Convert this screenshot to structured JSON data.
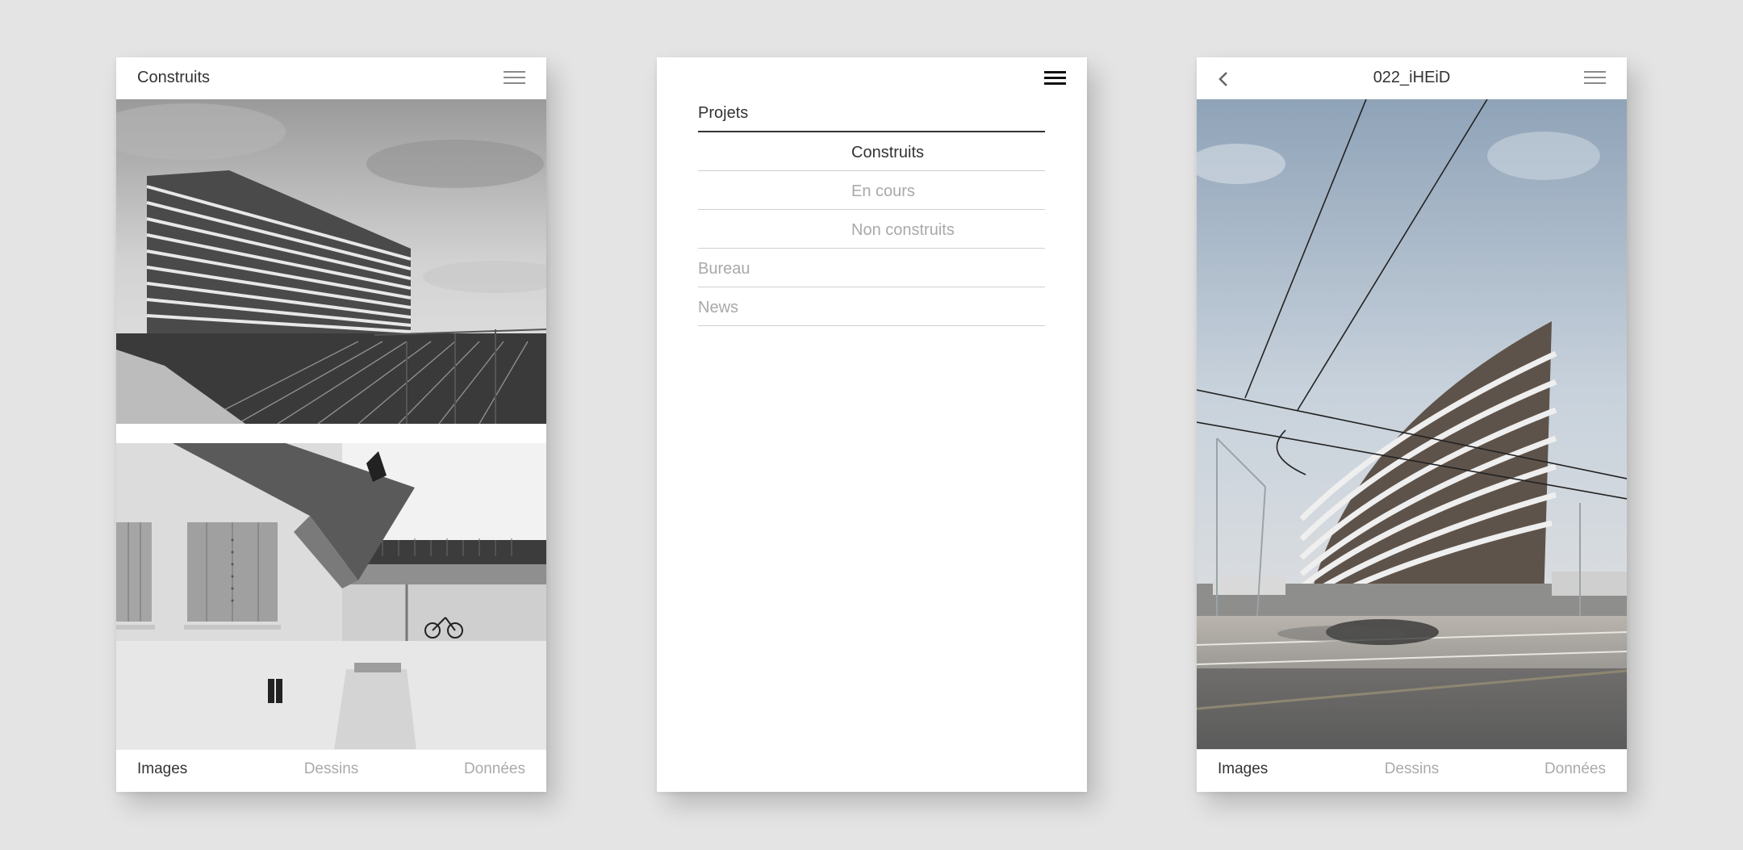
{
  "screen_list": {
    "title": "Construits",
    "tabs": [
      "Images",
      "Dessins",
      "Données"
    ],
    "active_tab": 0
  },
  "screen_menu": {
    "items": [
      {
        "label": "Projets",
        "level": 0,
        "active": true
      },
      {
        "label": "Construits",
        "level": 1,
        "active": true
      },
      {
        "label": "En cours",
        "level": 1,
        "active": false
      },
      {
        "label": "Non construits",
        "level": 1,
        "active": false
      },
      {
        "label": "Bureau",
        "level": 0,
        "active": false
      },
      {
        "label": "News",
        "level": 0,
        "active": false
      }
    ]
  },
  "screen_detail": {
    "title": "022_iHEiD",
    "tabs": [
      "Images",
      "Dessins",
      "Données"
    ],
    "active_tab": 0
  },
  "icons": {
    "menu": "hamburger-menu-icon",
    "back": "chevron-left-icon"
  },
  "colors": {
    "background": "#e4e4e4",
    "text_active": "#333333",
    "text_inactive": "#aaaaaa"
  }
}
